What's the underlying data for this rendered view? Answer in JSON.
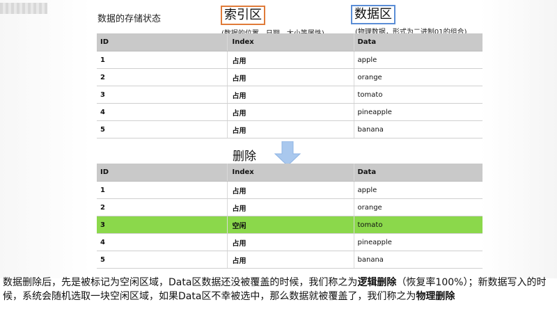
{
  "header": {
    "title": "数据的存储状态",
    "index_zone_label": "索引区",
    "index_zone_note": "(数据的位置、日期、大小等属性)",
    "data_zone_label": "数据区",
    "data_zone_note": "(物理数据，形式为二进制01的组合)"
  },
  "table_before": {
    "columns": [
      "ID",
      "Index",
      "Data"
    ],
    "rows": [
      {
        "id": "1",
        "index": "占用",
        "data": "apple"
      },
      {
        "id": "2",
        "index": "占用",
        "data": "orange"
      },
      {
        "id": "3",
        "index": "占用",
        "data": "tomato"
      },
      {
        "id": "4",
        "index": "占用",
        "data": "pineapple"
      },
      {
        "id": "5",
        "index": "占用",
        "data": "banana"
      }
    ]
  },
  "transition": {
    "label": "删除",
    "arrow_icon": "arrow-down-icon",
    "arrow_color": "#a9c8ee"
  },
  "table_after": {
    "columns": [
      "ID",
      "Index",
      "Data"
    ],
    "rows": [
      {
        "id": "1",
        "index": "占用",
        "data": "apple"
      },
      {
        "id": "2",
        "index": "占用",
        "data": "orange"
      },
      {
        "id": "3",
        "index": "空闲",
        "data": "tomato",
        "highlight": true
      },
      {
        "id": "4",
        "index": "占用",
        "data": "pineapple"
      },
      {
        "id": "5",
        "index": "占用",
        "data": "banana"
      }
    ],
    "highlight_color": "#8bd84b"
  },
  "caption": {
    "part1": "数据删除后，先是被标记为空闲区域，Data区数据还没被覆盖的时候，我们称之为",
    "term1": "逻辑删除",
    "part2": "（恢复率100%）；新数据写入的时候，系统会随机选取一块空闲区域，如果Data区不幸被选中，那么数据就被覆盖了，我们称之为",
    "term2": "物理删除"
  },
  "colors": {
    "index_border": "#e07b39",
    "data_border": "#5a8dd6",
    "header_bg": "#c9c9c9"
  }
}
